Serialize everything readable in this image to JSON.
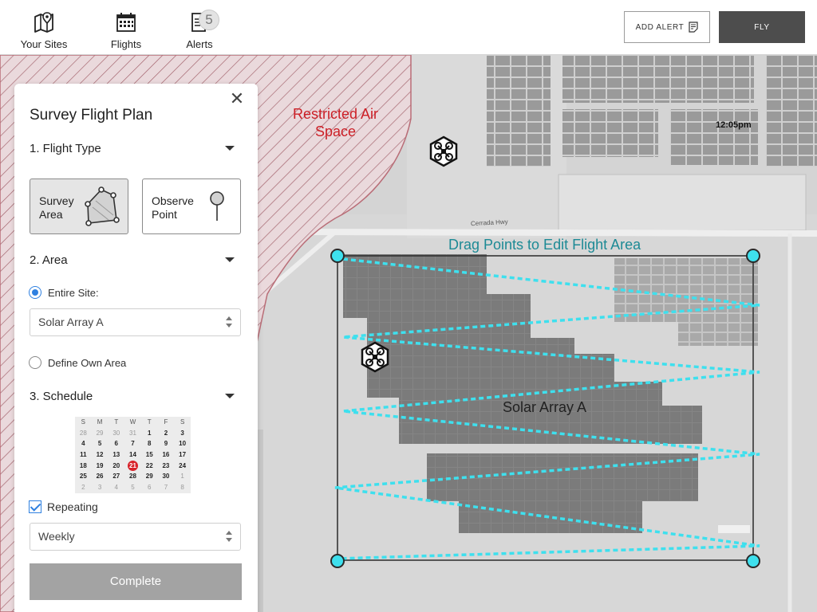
{
  "nav": {
    "sites_label": "Your Sites",
    "flights_label": "Flights",
    "alerts_label": "Alerts",
    "alerts_count": "5",
    "icons": {
      "sites": "map-pin-icon",
      "flights": "calendar-icon",
      "alerts": "document-icon"
    }
  },
  "actions": {
    "add_alert_label": "ADD ALERT",
    "fly_label": "FLY"
  },
  "map": {
    "restricted_label": "Restricted Air Space",
    "clock": "12:05pm",
    "drag_hint": "Drag Points to Edit Flight Area",
    "area_name": "Solar Array A",
    "road_label": "Cerrada Hwy",
    "colors": {
      "restricted": "#cc1f26",
      "flight_path": "#3ee0ee",
      "hint": "#1d8a95"
    }
  },
  "panel": {
    "title": "Survey Flight Plan",
    "section1": "1. Flight Type",
    "survey_area_label": "Survey\nArea",
    "observe_point_label": "Observe\nPoint",
    "selected_type": "Survey Area",
    "section2": "2. Area",
    "entire_site_label": "Entire Site:",
    "site_select_value": "Solar Array A",
    "define_area_label": "Define Own Area",
    "section3": "3. Schedule",
    "calendar": {
      "weekdays": [
        "S",
        "M",
        "T",
        "W",
        "T",
        "F",
        "S"
      ],
      "days": [
        [
          "28",
          "29",
          "30",
          "31",
          "1",
          "2",
          "3"
        ],
        [
          "4",
          "5",
          "6",
          "7",
          "8",
          "9",
          "10"
        ],
        [
          "11",
          "12",
          "13",
          "14",
          "15",
          "16",
          "17"
        ],
        [
          "18",
          "19",
          "20",
          "21",
          "22",
          "23",
          "24"
        ],
        [
          "25",
          "26",
          "27",
          "28",
          "29",
          "30",
          "1"
        ],
        [
          "2",
          "3",
          "4",
          "5",
          "6",
          "7",
          "8"
        ]
      ],
      "selected": "21"
    },
    "repeating_label": "Repeating",
    "repeating_checked": true,
    "frequency_value": "Weekly",
    "complete_label": "Complete"
  }
}
